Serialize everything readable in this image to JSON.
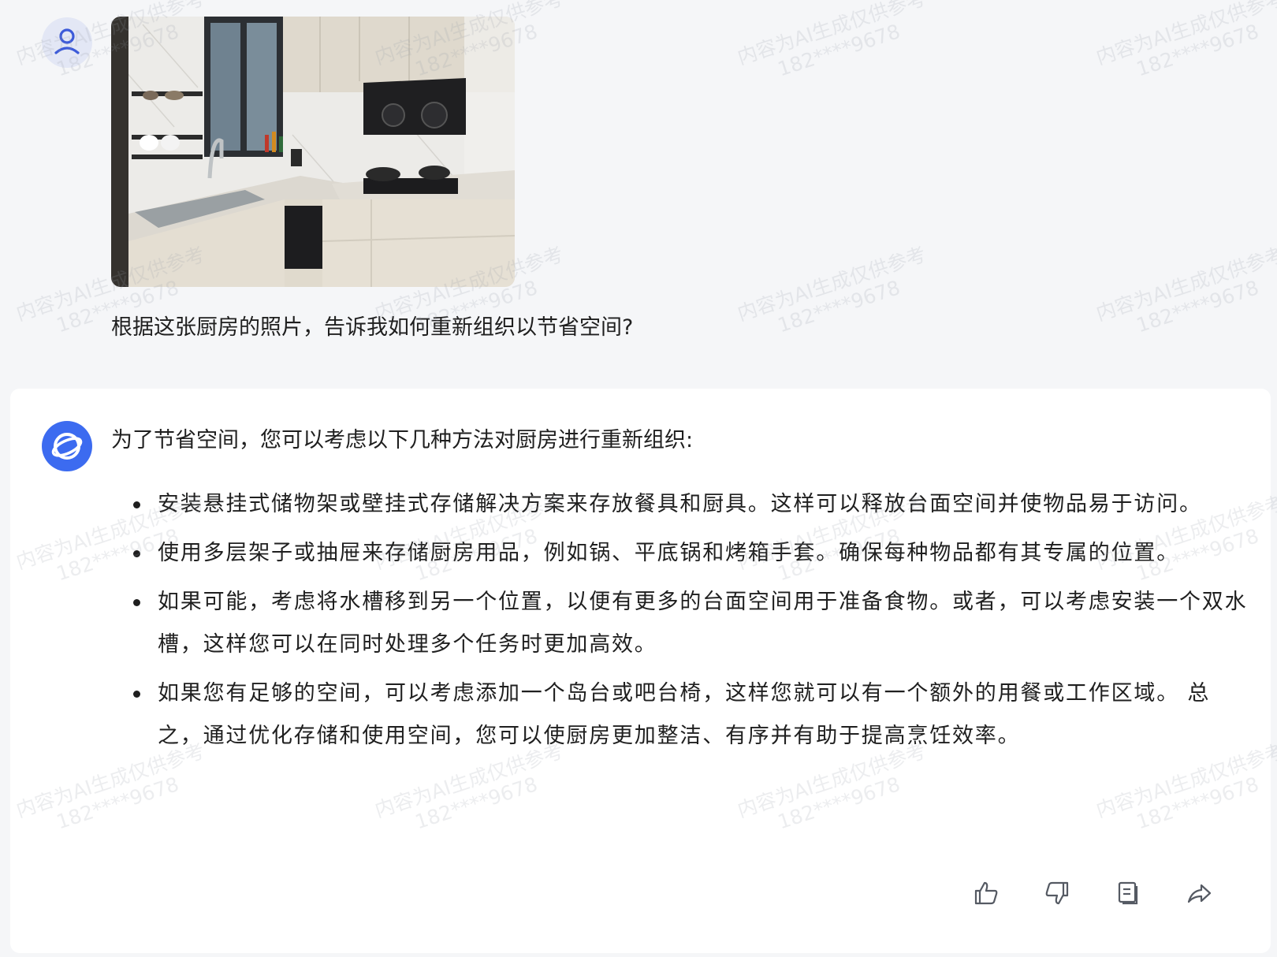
{
  "user_message": {
    "avatar_icon": "user-icon",
    "image_alt": "kitchen photo",
    "text": "根据这张厨房的照片，告诉我如何重新组织以节省空间?"
  },
  "assistant_message": {
    "avatar_icon": "assistant-logo-icon",
    "intro": "为了节省空间，您可以考虑以下几种方法对厨房进行重新组织:",
    "items": [
      "安装悬挂式储物架或壁挂式存储解决方案来存放餐具和厨具。这样可以释放台面空间并使物品易于访问。",
      "使用多层架子或抽屉来存储厨房用品，例如锅、平底锅和烤箱手套。确保每种物品都有其专属的位置。",
      "如果可能，考虑将水槽移到另一个位置，以便有更多的台面空间用于准备食物。或者，可以考虑安装一个双水槽，这样您可以在同时处理多个任务时更加高效。",
      "如果您有足够的空间，可以考虑添加一个岛台或吧台椅，这样您就可以有一个额外的用餐或工作区域。 总之，通过优化存储和使用空间，您可以使厨房更加整洁、有序并有助于提高烹饪效率。"
    ],
    "actions": [
      {
        "name": "like",
        "icon": "thumbs-up-icon"
      },
      {
        "name": "dislike",
        "icon": "thumbs-down-icon"
      },
      {
        "name": "copy",
        "icon": "copy-icon"
      },
      {
        "name": "share",
        "icon": "share-icon"
      }
    ]
  },
  "watermark": {
    "line1": "内容为AI生成仅供参考",
    "line2": "182****9678"
  },
  "colors": {
    "page_bg": "#f5f6f8",
    "card_bg": "#ffffff",
    "accent": "#3c6bf0",
    "text": "#1f1f1f"
  }
}
